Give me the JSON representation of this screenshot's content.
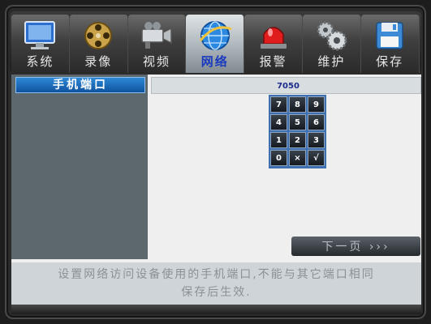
{
  "tabs": [
    {
      "label": "系统",
      "icon": "monitor-icon"
    },
    {
      "label": "录像",
      "icon": "film-reel-icon"
    },
    {
      "label": "视频",
      "icon": "camera-icon"
    },
    {
      "label": "网络",
      "icon": "globe-icon",
      "active": true
    },
    {
      "label": "报警",
      "icon": "alarm-light-icon"
    },
    {
      "label": "维护",
      "icon": "gears-icon"
    },
    {
      "label": "保存",
      "icon": "floppy-disk-icon"
    }
  ],
  "sidebar": {
    "items": [
      {
        "label": "手机端口",
        "selected": true
      }
    ]
  },
  "port": {
    "value": "7050"
  },
  "numpad": {
    "keys": [
      "7",
      "8",
      "9",
      "4",
      "5",
      "6",
      "1",
      "2",
      "3",
      "0",
      "×",
      "√"
    ]
  },
  "next_button": {
    "label": "下一页 ›››"
  },
  "info": {
    "line1": "设置网络访问设备使用的手机端口,不能与其它端口相同",
    "line2": "保存后生效."
  },
  "colors": {
    "active_tab_label": "#1a3bbf",
    "sidebar_selected": "#1f6fbf",
    "numpad_bg": "#3e6fb0"
  }
}
